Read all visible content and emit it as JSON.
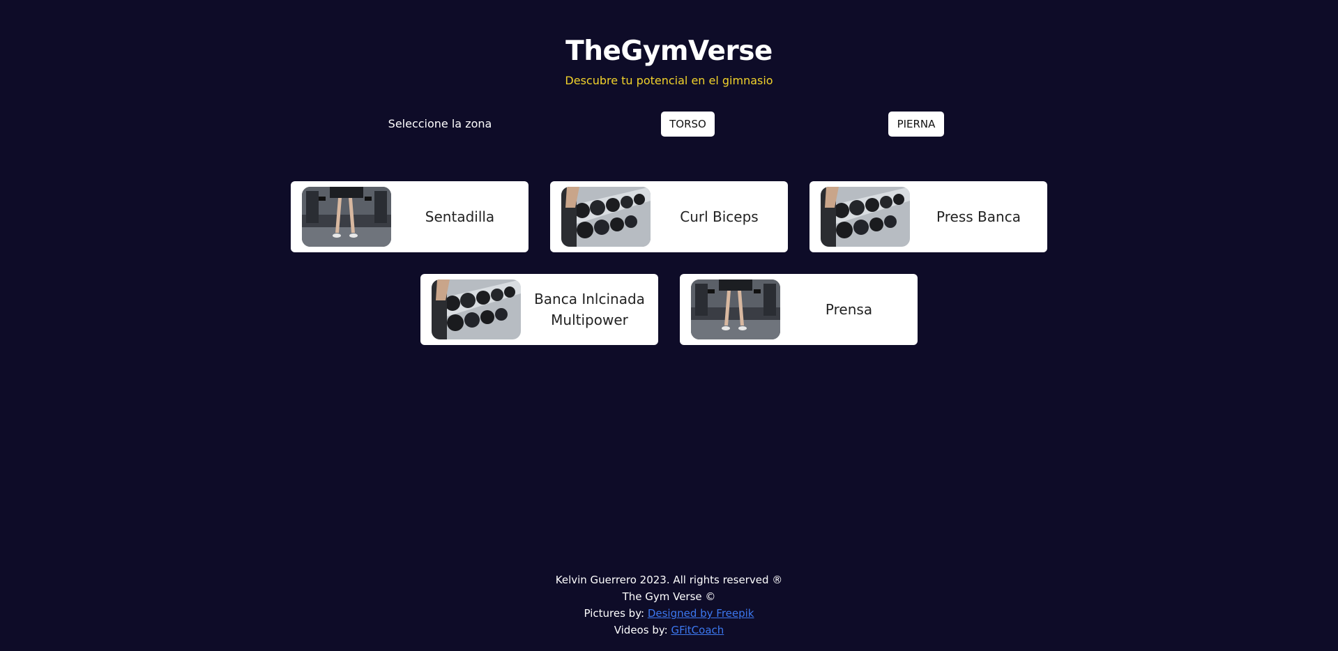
{
  "header": {
    "title": "TheGymVerse",
    "subtitle": "Descubre tu potencial en el gimnasio"
  },
  "zone_selector": {
    "label": "Seleccione la zona",
    "buttons": [
      "TORSO",
      "PIERNA"
    ]
  },
  "exercises": [
    {
      "name": "Sentadilla",
      "image": "legs-squat-photo"
    },
    {
      "name": "Curl Biceps",
      "image": "dumbbell-rack-photo"
    },
    {
      "name": "Press Banca",
      "image": "dumbbell-rack-photo"
    },
    {
      "name": "Banca Inlcinada Multipower",
      "image": "dumbbell-rack-photo"
    },
    {
      "name": "Prensa",
      "image": "legs-squat-photo"
    }
  ],
  "footer": {
    "copyright": "Kelvin Guerrero 2023. All rights reserved ®",
    "brand": "The Gym Verse ©",
    "pictures_prefix": "Pictures by:",
    "pictures_link": "Designed by Freepik",
    "videos_prefix": "Videos by:",
    "videos_link": "GFitCoach"
  },
  "colors": {
    "background": "#0e0c28",
    "accent": "#f2d32b",
    "link": "#3c78f0",
    "card": "#ffffff"
  }
}
